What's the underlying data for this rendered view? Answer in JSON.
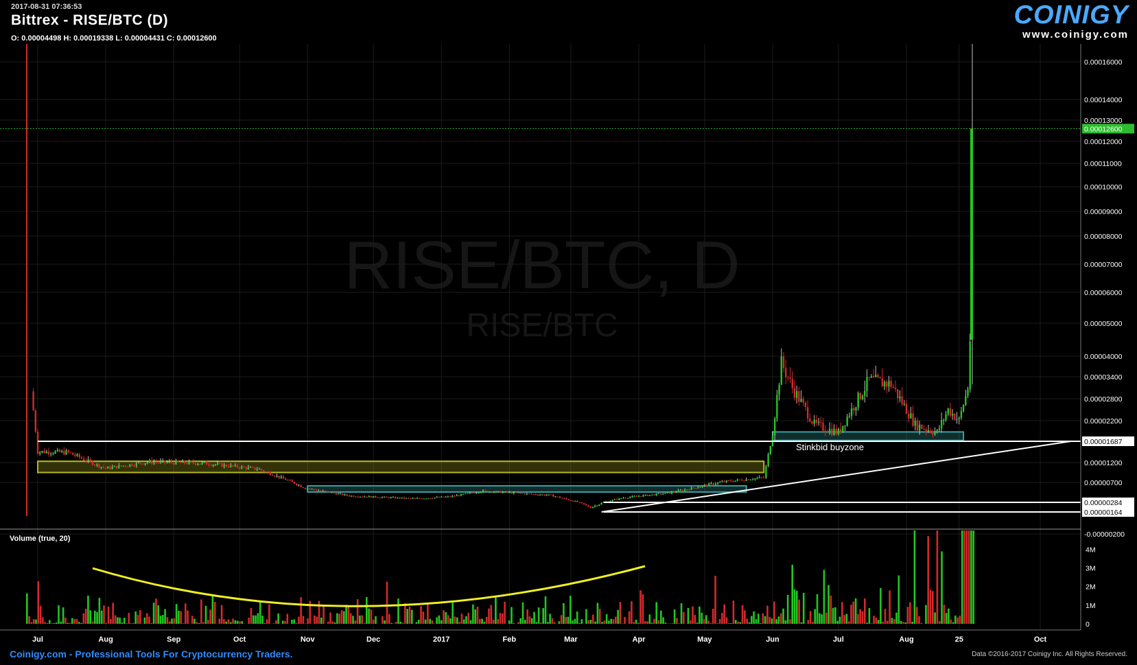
{
  "header": {
    "timestamp": "2017-08-31 07:36:53",
    "title": "Bittrex - RISE/BTC (D)",
    "ohlc": "O: 0.00004498 H: 0.00019338 L: 0.00004431 C: 0.00012600"
  },
  "logo": {
    "name": "COINIGY",
    "url": "www.coinigy.com"
  },
  "watermark": {
    "main": "RISE/BTC, D",
    "sub": "RISE/BTC"
  },
  "footer": {
    "left": "Coinigy.com - Professional Tools For Cryptocurrency Traders.",
    "right": "Data ©2016-2017 Coinigy Inc. All Rights Reserved."
  },
  "colors": {
    "up": "#21c821",
    "down": "#d42a2a",
    "wick_up": "#bfbfbf",
    "line": "#ffffff",
    "accent": "#4aa9ff",
    "zone_yellow": "#b5b520",
    "zone_teal": "#3aa0a0",
    "curve": "#f0f020",
    "price_tag": "#2ebd2e"
  },
  "chart_data": [
    {
      "type": "candlestick",
      "title": "Bittrex - RISE/BTC (D)",
      "x_axis_ticks": [
        "Jul",
        "Aug",
        "Sep",
        "Oct",
        "Nov",
        "Dec",
        "2017",
        "Feb",
        "Mar",
        "Apr",
        "May",
        "Jun",
        "Jul",
        "Aug",
        "25",
        "Oct"
      ],
      "y_axis_ticks": [
        "0.00016000",
        "0.00014000",
        "0.00013000",
        "0.00012000",
        "0.00011000",
        "0.00010000",
        "0.00009000",
        "0.00008000",
        "0.00007000",
        "0.00006000",
        "0.00005000",
        "0.00004000",
        "0.00003400",
        "0.00002800",
        "0.00002200",
        "0.00001687",
        "0.00001200",
        "0.00000700",
        "0.00000284",
        "0.00000164",
        "-0.00000200"
      ],
      "last_price_label": "0.00012600",
      "ohlc_last": {
        "open": 4.498e-05,
        "high": 0.00019338,
        "low": 4.431e-05,
        "close": 0.000126
      },
      "price_path": [
        [
          "2016-06-28",
          3e-05
        ],
        [
          "2016-07-01",
          1.45e-05
        ],
        [
          "2016-07-15",
          1.43e-05
        ],
        [
          "2016-08-01",
          1.05e-05
        ],
        [
          "2016-08-20",
          1.21e-05
        ],
        [
          "2016-09-15",
          1.18e-05
        ],
        [
          "2016-10-10",
          1.03e-05
        ],
        [
          "2016-10-31",
          5.8e-06
        ],
        [
          "2016-11-20",
          4.2e-06
        ],
        [
          "2016-12-20",
          3.6e-06
        ],
        [
          "2017-01-05",
          4e-06
        ],
        [
          "2017-01-20",
          5.2e-06
        ],
        [
          "2017-02-20",
          4.3e-06
        ],
        [
          "2017-03-10",
          2.2e-06
        ],
        [
          "2017-03-25",
          3.8e-06
        ],
        [
          "2017-04-15",
          4.8e-06
        ],
        [
          "2017-05-10",
          7.2e-06
        ],
        [
          "2017-05-28",
          8.2e-06
        ],
        [
          "2017-06-01",
          1.9e-05
        ],
        [
          "2017-06-05",
          3.8e-05
        ],
        [
          "2017-06-10",
          3.1e-05
        ],
        [
          "2017-06-20",
          2.1e-05
        ],
        [
          "2017-07-01",
          1.9e-05
        ],
        [
          "2017-07-15",
          3.3e-05
        ],
        [
          "2017-07-25",
          3.2e-05
        ],
        [
          "2017-08-05",
          2.1e-05
        ],
        [
          "2017-08-15",
          1.9e-05
        ],
        [
          "2017-08-20",
          2.5e-05
        ],
        [
          "2017-08-25",
          2.2e-05
        ],
        [
          "2017-08-29",
          3.1e-05
        ],
        [
          "2017-08-30",
          4.5e-05
        ],
        [
          "2017-08-31",
          0.000126
        ]
      ],
      "annotations": [
        {
          "type": "horizontal_line",
          "value": 1.687e-05
        },
        {
          "type": "horizontal_line",
          "value": 2.84e-06
        },
        {
          "type": "horizontal_line",
          "value": 1.64e-06
        },
        {
          "type": "trendline",
          "from": [
            "2017-03-15",
            1.64e-06
          ],
          "to": [
            "2017-10-15",
            1.687e-05
          ]
        },
        {
          "type": "zone",
          "color": "yellow",
          "from": "2016-07-01",
          "to": "2017-05-28",
          "low": 9.5e-06,
          "high": 1.23e-05
        },
        {
          "type": "zone",
          "color": "teal",
          "from": "2016-11-01",
          "to": "2017-05-20",
          "low": 5e-06,
          "high": 6.3e-06
        },
        {
          "type": "zone",
          "color": "teal",
          "from": "2017-06-01",
          "to": "2017-08-27",
          "low": 1.71e-05,
          "high": 1.92e-05
        }
      ],
      "annotation_text": "Stinkbid buyzone"
    },
    {
      "type": "bar",
      "title": "Volume (true, 20)",
      "y_axis_ticks": [
        "4M",
        "3M",
        "2M",
        "1M",
        "0"
      ],
      "ylim": [
        0,
        5000000
      ],
      "annotations": [
        {
          "type": "curve",
          "label": "volume rounding bottom"
        }
      ]
    }
  ]
}
